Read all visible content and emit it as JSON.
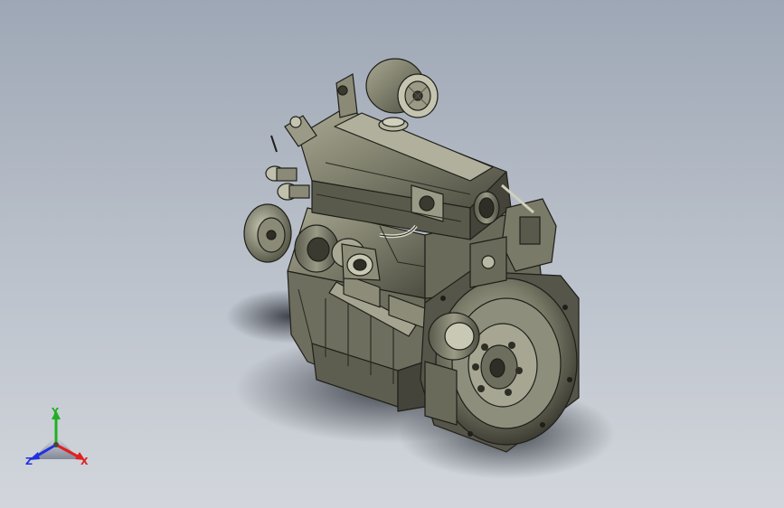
{
  "viewport": {
    "background_top": "#9ea7b5",
    "background_bottom": "#d2d6dc"
  },
  "model": {
    "icon": "engine-model",
    "body_color": "#8a8a78",
    "shade_color": "#4a4a3e",
    "edge_color": "#1f1f1a"
  },
  "triad": {
    "icon": "axis-triad-icon",
    "x_label": "X",
    "y_label": "Y",
    "z_label": "Z",
    "x_color": "#e02020",
    "y_color": "#20b020",
    "z_color": "#2030e0"
  }
}
